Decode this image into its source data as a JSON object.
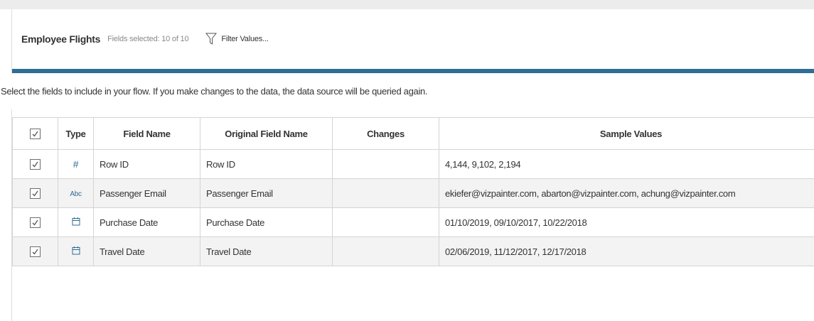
{
  "header": {
    "title": "Employee Flights",
    "fields_selected": "Fields selected: 10 of 10",
    "filter_label": "Filter Values..."
  },
  "instructions": "Select the fields to include in your flow. If you make changes to the data, the data source will be queried again.",
  "table": {
    "columns": {
      "type": "Type",
      "field_name": "Field Name",
      "original_field_name": "Original Field Name",
      "changes": "Changes",
      "sample_values": "Sample Values"
    },
    "rows": [
      {
        "checked": true,
        "type_icon": "number-icon",
        "type_glyph": "#",
        "field_name": "Row ID",
        "original_field_name": "Row ID",
        "changes": "",
        "sample_values": "4,144, 9,102, 2,194"
      },
      {
        "checked": true,
        "type_icon": "string-icon",
        "type_glyph": "Abc",
        "field_name": "Passenger Email",
        "original_field_name": "Passenger Email",
        "changes": "",
        "sample_values": "ekiefer@vizpainter.com, abarton@vizpainter.com, achung@vizpainter.com"
      },
      {
        "checked": true,
        "type_icon": "date-icon",
        "type_glyph": "",
        "field_name": "Purchase Date",
        "original_field_name": "Purchase Date",
        "changes": "",
        "sample_values": "01/10/2019, 09/10/2017, 10/22/2018"
      },
      {
        "checked": true,
        "type_icon": "date-icon",
        "type_glyph": "",
        "field_name": "Travel Date",
        "original_field_name": "Travel Date",
        "changes": "",
        "sample_values": "02/06/2019, 11/12/2017, 12/17/2018"
      }
    ]
  },
  "colors": {
    "accent": "#2f6e95",
    "row_alt": "#f3f3f3",
    "border": "#d4d4d4"
  }
}
